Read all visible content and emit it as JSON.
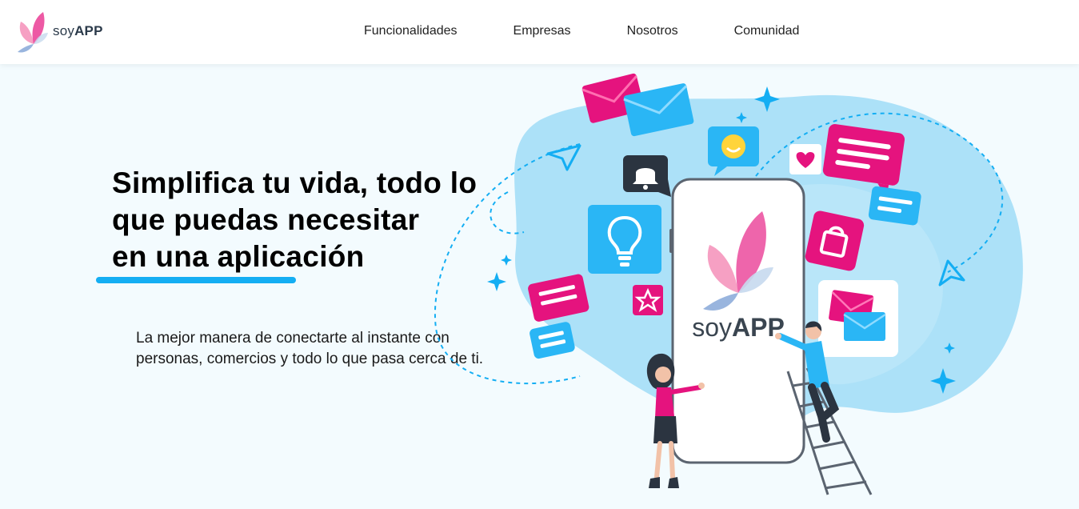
{
  "brand": {
    "name_light": "soy",
    "name_bold": "APP",
    "logo_icon": "butterfly-logo-icon"
  },
  "nav": {
    "items": [
      {
        "label": "Funcionalidades"
      },
      {
        "label": "Empresas"
      },
      {
        "label": "Nosotros"
      },
      {
        "label": "Comunidad"
      }
    ]
  },
  "hero": {
    "title_line1": "Simplifica tu vida, todo lo",
    "title_line2": "que puedas necesitar",
    "title_line3": "en una aplicación",
    "subtitle": "La mejor manera de conectarte al instante con personas, comercios y todo lo que pasa cerca de ti."
  },
  "illustration": {
    "phone_brand_light": "soy",
    "phone_brand_bold": "APP",
    "icons": [
      "mail-icon",
      "bell-icon",
      "smiley-chat-icon",
      "heart-icon",
      "chat-icon",
      "lightbulb-icon",
      "shopping-bag-icon",
      "star-icon",
      "paper-plane-icon",
      "sparkle-icon"
    ]
  },
  "colors": {
    "accent_blue": "#14aef3",
    "accent_pink": "#e5137e",
    "blob_blue": "#9fdcf7",
    "background": "#f3fbfe"
  }
}
